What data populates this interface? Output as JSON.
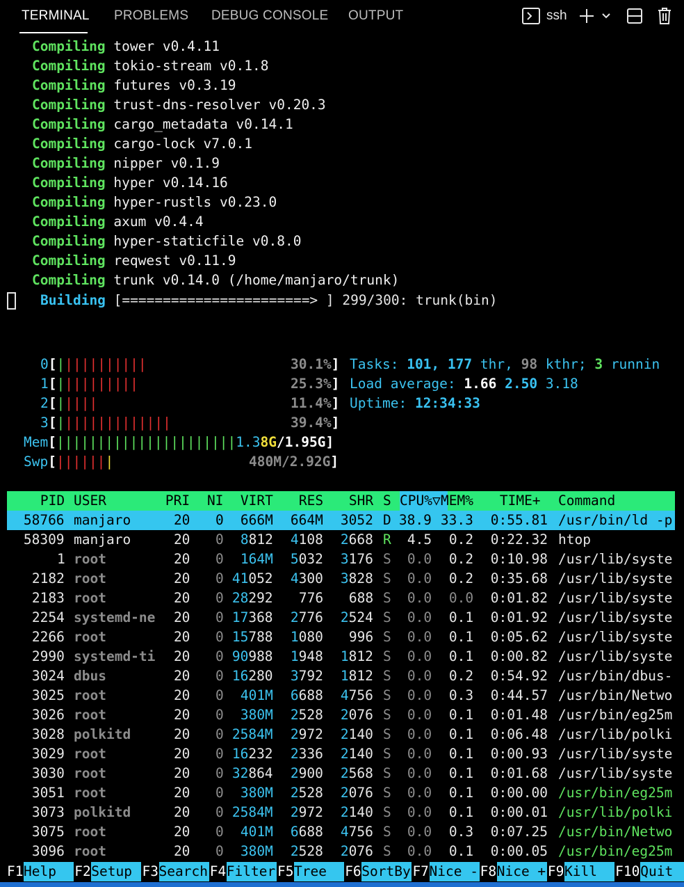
{
  "tabs": [
    {
      "label": "TERMINAL",
      "active": true
    },
    {
      "label": "PROBLEMS",
      "active": false
    },
    {
      "label": "DEBUG CONSOLE",
      "active": false
    },
    {
      "label": "OUTPUT",
      "active": false
    }
  ],
  "toolbar": {
    "shell_label": "ssh"
  },
  "build": {
    "compiling_label": "Compiling",
    "compiling": [
      "tower v0.4.11",
      "tokio-stream v0.1.8",
      "futures v0.3.19",
      "trust-dns-resolver v0.20.3",
      "cargo_metadata v0.14.1",
      "cargo-lock v7.0.1",
      "nipper v0.1.9",
      "hyper v0.14.16",
      "hyper-rustls v0.23.0",
      "axum v0.4.4",
      "hyper-staticfile v0.8.0",
      "reqwest v0.11.9",
      "trunk v0.14.0 (/home/manjaro/trunk)"
    ],
    "building_label": "Building",
    "progress_bar": "[=======================> ]",
    "progress_text": "299/300: trunk(bin)"
  },
  "meters": {
    "cpus": [
      {
        "id": "0",
        "bars": "||||||||||",
        "value": "30.1%"
      },
      {
        "id": "1",
        "bars": "|||||||||",
        "value": "25.3%"
      },
      {
        "id": "2",
        "bars": "||||",
        "value": "11.4%"
      },
      {
        "id": "3",
        "bars": "|||||||||||||",
        "value": "39.4%"
      }
    ],
    "mem": {
      "label": "Mem",
      "bars": "||||||||||||||||||||||",
      "used_a": "1.3",
      "used_b": "8G",
      "total": "/1.95G"
    },
    "swp": {
      "label": "Swp",
      "bars": "||||||",
      "value": "480M/2.92G"
    }
  },
  "stats": {
    "tasks_label": "Tasks:",
    "tasks": "101,",
    "threads": "177",
    "thr_label": "thr,",
    "kthr": "98",
    "kthr_label": "kthr;",
    "running": "3",
    "running_label": "runnin",
    "load_label": "Load average:",
    "load1": "1.66",
    "load5": "2.50",
    "load15": "3.18",
    "uptime_label": "Uptime:",
    "uptime": "12:34:33"
  },
  "columns": [
    "PID",
    "USER",
    "PRI",
    "NI",
    "VIRT",
    "RES",
    "SHR",
    "S",
    "CPU%▽",
    "MEM%",
    "TIME+",
    "Command"
  ],
  "processes": [
    {
      "pid": "58766",
      "user": "manjaro",
      "pri": "20",
      "ni": "0",
      "virt": "666M",
      "res": "664M",
      "shr": "3052",
      "s": "D",
      "cpu": "38.9",
      "mem": "33.3",
      "time": "0:55.81",
      "cmd": "/usr/bin/ld -p"
    },
    {
      "pid": "58309",
      "user": "manjaro",
      "pri": "20",
      "ni": "0",
      "virt": "8812",
      "res": "4108",
      "shr": "2668",
      "s": "R",
      "cpu": "4.5",
      "mem": "0.2",
      "time": "0:22.32",
      "cmd": "htop"
    },
    {
      "pid": "1",
      "user": "root",
      "pri": "20",
      "ni": "0",
      "virt": "164M",
      "res": "5032",
      "shr": "3176",
      "s": "S",
      "cpu": "0.0",
      "mem": "0.2",
      "time": "0:10.98",
      "cmd": "/usr/lib/syste"
    },
    {
      "pid": "2182",
      "user": "root",
      "pri": "20",
      "ni": "0",
      "virt": "41052",
      "res": "4300",
      "shr": "3828",
      "s": "S",
      "cpu": "0.0",
      "mem": "0.2",
      "time": "0:35.68",
      "cmd": "/usr/lib/syste"
    },
    {
      "pid": "2183",
      "user": "root",
      "pri": "20",
      "ni": "0",
      "virt": "28292",
      "res": "776",
      "shr": "688",
      "s": "S",
      "cpu": "0.0",
      "mem": "0.0",
      "time": "0:01.82",
      "cmd": "/usr/lib/syste"
    },
    {
      "pid": "2254",
      "user": "systemd-ne",
      "pri": "20",
      "ni": "0",
      "virt": "17368",
      "res": "2776",
      "shr": "2524",
      "s": "S",
      "cpu": "0.0",
      "mem": "0.1",
      "time": "0:01.92",
      "cmd": "/usr/lib/syste"
    },
    {
      "pid": "2266",
      "user": "root",
      "pri": "20",
      "ni": "0",
      "virt": "15788",
      "res": "1080",
      "shr": "996",
      "s": "S",
      "cpu": "0.0",
      "mem": "0.1",
      "time": "0:05.62",
      "cmd": "/usr/lib/syste"
    },
    {
      "pid": "2990",
      "user": "systemd-ti",
      "pri": "20",
      "ni": "0",
      "virt": "90988",
      "res": "1948",
      "shr": "1812",
      "s": "S",
      "cpu": "0.0",
      "mem": "0.1",
      "time": "0:00.82",
      "cmd": "/usr/lib/syste"
    },
    {
      "pid": "3024",
      "user": "dbus",
      "pri": "20",
      "ni": "0",
      "virt": "16280",
      "res": "3792",
      "shr": "1812",
      "s": "S",
      "cpu": "0.0",
      "mem": "0.2",
      "time": "0:54.92",
      "cmd": "/usr/bin/dbus-"
    },
    {
      "pid": "3025",
      "user": "root",
      "pri": "20",
      "ni": "0",
      "virt": "401M",
      "res": "6688",
      "shr": "4756",
      "s": "S",
      "cpu": "0.0",
      "mem": "0.3",
      "time": "0:44.57",
      "cmd": "/usr/bin/Netwo"
    },
    {
      "pid": "3026",
      "user": "root",
      "pri": "20",
      "ni": "0",
      "virt": "380M",
      "res": "2528",
      "shr": "2076",
      "s": "S",
      "cpu": "0.0",
      "mem": "0.1",
      "time": "0:01.48",
      "cmd": "/usr/bin/eg25m"
    },
    {
      "pid": "3028",
      "user": "polkitd",
      "pri": "20",
      "ni": "0",
      "virt": "2584M",
      "res": "2972",
      "shr": "2140",
      "s": "S",
      "cpu": "0.0",
      "mem": "0.1",
      "time": "0:06.48",
      "cmd": "/usr/lib/polki"
    },
    {
      "pid": "3029",
      "user": "root",
      "pri": "20",
      "ni": "0",
      "virt": "16232",
      "res": "2336",
      "shr": "2140",
      "s": "S",
      "cpu": "0.0",
      "mem": "0.1",
      "time": "0:00.93",
      "cmd": "/usr/lib/syste"
    },
    {
      "pid": "3030",
      "user": "root",
      "pri": "20",
      "ni": "0",
      "virt": "32864",
      "res": "2900",
      "shr": "2568",
      "s": "S",
      "cpu": "0.0",
      "mem": "0.1",
      "time": "0:01.68",
      "cmd": "/usr/lib/syste"
    },
    {
      "pid": "3051",
      "user": "root",
      "pri": "20",
      "ni": "0",
      "virt": "380M",
      "res": "2528",
      "shr": "2076",
      "s": "S",
      "cpu": "0.0",
      "mem": "0.1",
      "time": "0:00.00",
      "cmd": "/usr/bin/eg25m",
      "thread": true
    },
    {
      "pid": "3073",
      "user": "polkitd",
      "pri": "20",
      "ni": "0",
      "virt": "2584M",
      "res": "2972",
      "shr": "2140",
      "s": "S",
      "cpu": "0.0",
      "mem": "0.1",
      "time": "0:00.01",
      "cmd": "/usr/lib/polki",
      "thread": true
    },
    {
      "pid": "3075",
      "user": "root",
      "pri": "20",
      "ni": "0",
      "virt": "401M",
      "res": "6688",
      "shr": "4756",
      "s": "S",
      "cpu": "0.0",
      "mem": "0.3",
      "time": "0:07.25",
      "cmd": "/usr/bin/Netwo",
      "thread": true
    },
    {
      "pid": "3096",
      "user": "root",
      "pri": "20",
      "ni": "0",
      "virt": "380M",
      "res": "2528",
      "shr": "2076",
      "s": "S",
      "cpu": "0.0",
      "mem": "0.1",
      "time": "0:00.05",
      "cmd": "/usr/bin/eg25m",
      "thread": true
    }
  ],
  "function_keys": [
    {
      "key": "F1",
      "label": "Help  "
    },
    {
      "key": "F2",
      "label": "Setup "
    },
    {
      "key": "F3",
      "label": "Search"
    },
    {
      "key": "F4",
      "label": "Filter"
    },
    {
      "key": "F5",
      "label": "Tree  "
    },
    {
      "key": "F6",
      "label": "SortBy"
    },
    {
      "key": "F7",
      "label": "Nice -"
    },
    {
      "key": "F8",
      "label": "Nice +"
    },
    {
      "key": "F9",
      "label": "Kill  "
    },
    {
      "key": "F10",
      "label": "Quit  "
    }
  ],
  "colors": {
    "accent_cyan": "#35c6ef",
    "header_green": "#2bea79",
    "compile_green": "#5fe35f",
    "cpu_red": "#e33030",
    "statusbar_blue": "#1e6fd1"
  }
}
